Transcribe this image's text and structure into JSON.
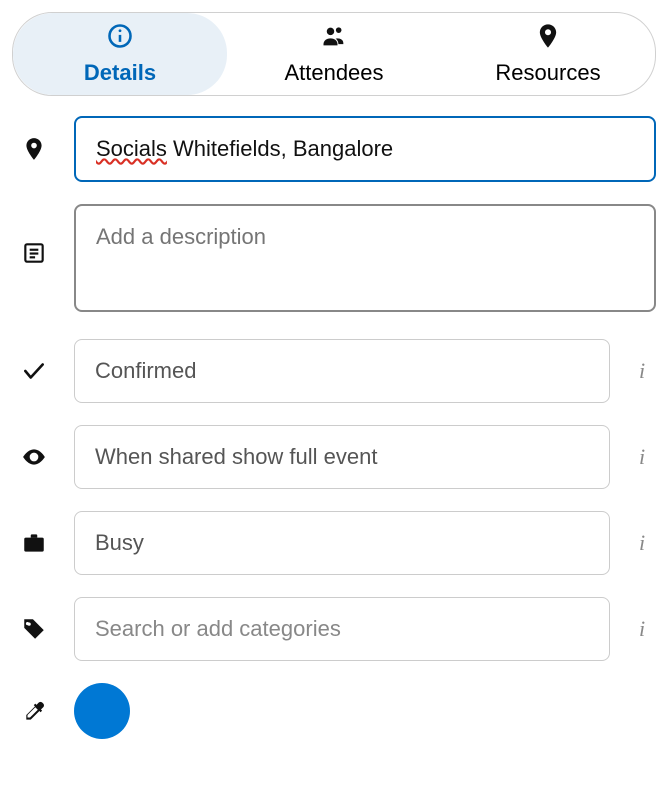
{
  "tabs": {
    "details": "Details",
    "attendees": "Attendees",
    "resources": "Resources",
    "active": "details"
  },
  "location": {
    "value": "Socials Whitefields, Bangalore",
    "misspelled_word": "Socials"
  },
  "description": {
    "placeholder": "Add a description"
  },
  "status": {
    "value": "Confirmed"
  },
  "visibility": {
    "value": "When shared show full event"
  },
  "availability": {
    "value": "Busy"
  },
  "categories": {
    "placeholder": "Search or add categories"
  },
  "color": {
    "value": "#0078d4"
  },
  "info_glyph": "i"
}
